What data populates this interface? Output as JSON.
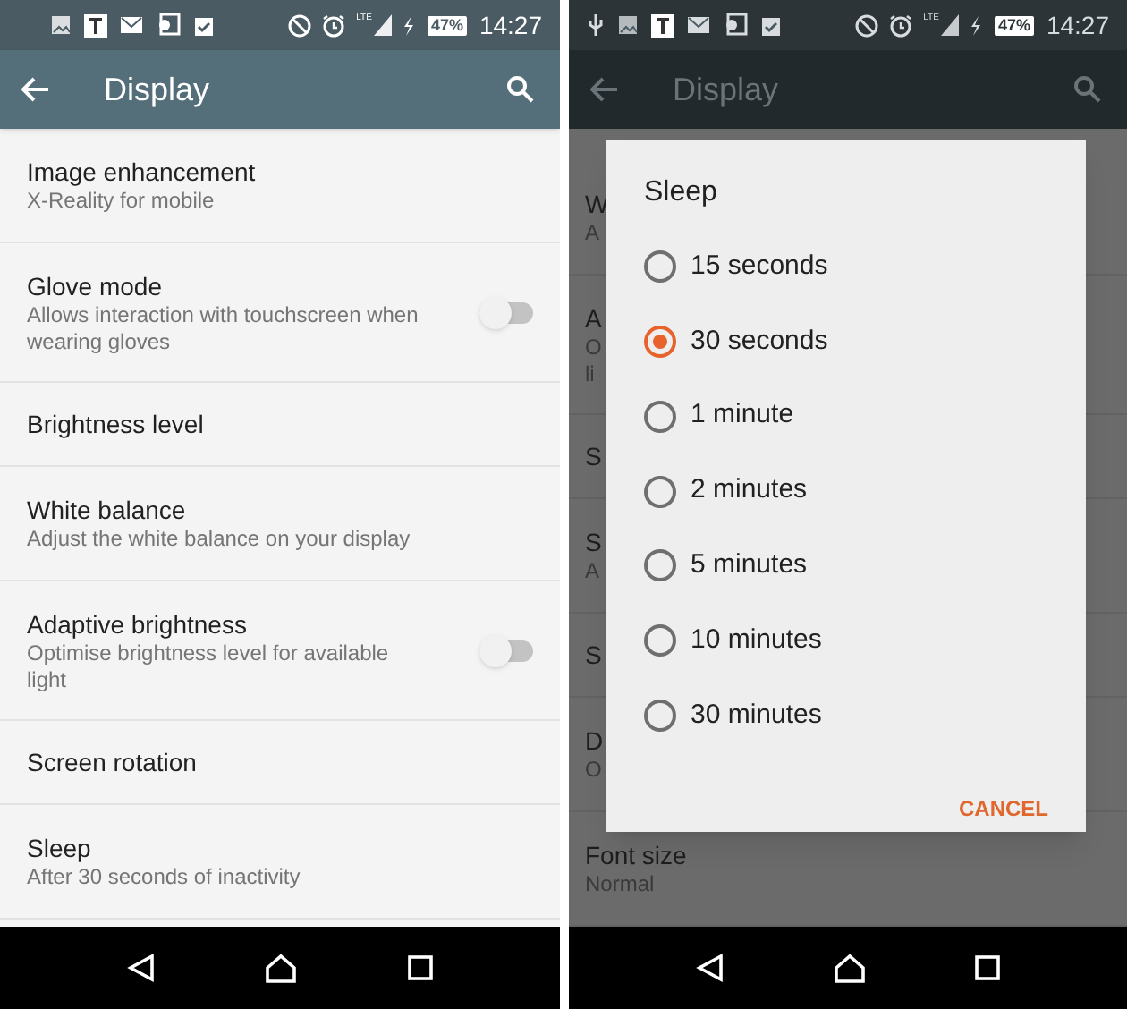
{
  "panels": [
    {
      "dimmed": false,
      "status_bar": {
        "usb_connected": false,
        "network": "LTE",
        "battery": "47%",
        "time": "14:27"
      },
      "app_bar": {
        "title": "Display"
      },
      "list": [
        {
          "kind": "text",
          "title": "Image enhancement",
          "subtitle": "X-Reality for mobile"
        },
        {
          "kind": "toggle",
          "title": "Glove mode",
          "subtitle": "Allows interaction with touchscreen when wearing gloves",
          "on": false
        },
        {
          "kind": "text",
          "title": "Brightness level"
        },
        {
          "kind": "text",
          "title": "White balance",
          "subtitle": "Adjust the white balance on your display"
        },
        {
          "kind": "toggle",
          "title": "Adaptive brightness",
          "subtitle": "Optimise brightness level for available light",
          "on": false
        },
        {
          "kind": "text",
          "title": "Screen rotation"
        },
        {
          "kind": "text",
          "title": "Sleep",
          "subtitle": "After 30 seconds of inactivity"
        }
      ]
    },
    {
      "dimmed": true,
      "status_bar": {
        "usb_connected": true,
        "network": "LTE",
        "battery": "47%",
        "time": "14:27"
      },
      "app_bar": {
        "title": "Display"
      },
      "list": [
        {
          "kind": "text",
          "title": "W",
          "subtitle": "A"
        },
        {
          "kind": "text",
          "title": "A",
          "subtitle": "O",
          "subtitle_2": "li"
        },
        {
          "kind": "text",
          "title": "S"
        },
        {
          "kind": "text",
          "title": "S",
          "subtitle": "A"
        },
        {
          "kind": "text",
          "title": "S"
        },
        {
          "kind": "text",
          "title": "D",
          "subtitle": "O"
        },
        {
          "kind": "text",
          "title": "Font size",
          "subtitle": "Normal"
        }
      ],
      "dialog": {
        "title": "Sleep",
        "options": [
          {
            "label": "15 seconds",
            "selected": false
          },
          {
            "label": "30 seconds",
            "selected": true
          },
          {
            "label": "1 minute",
            "selected": false
          },
          {
            "label": "2 minutes",
            "selected": false
          },
          {
            "label": "5 minutes",
            "selected": false
          },
          {
            "label": "10 minutes",
            "selected": false
          },
          {
            "label": "30 minutes",
            "selected": false
          }
        ],
        "button": "CANCEL"
      }
    }
  ]
}
